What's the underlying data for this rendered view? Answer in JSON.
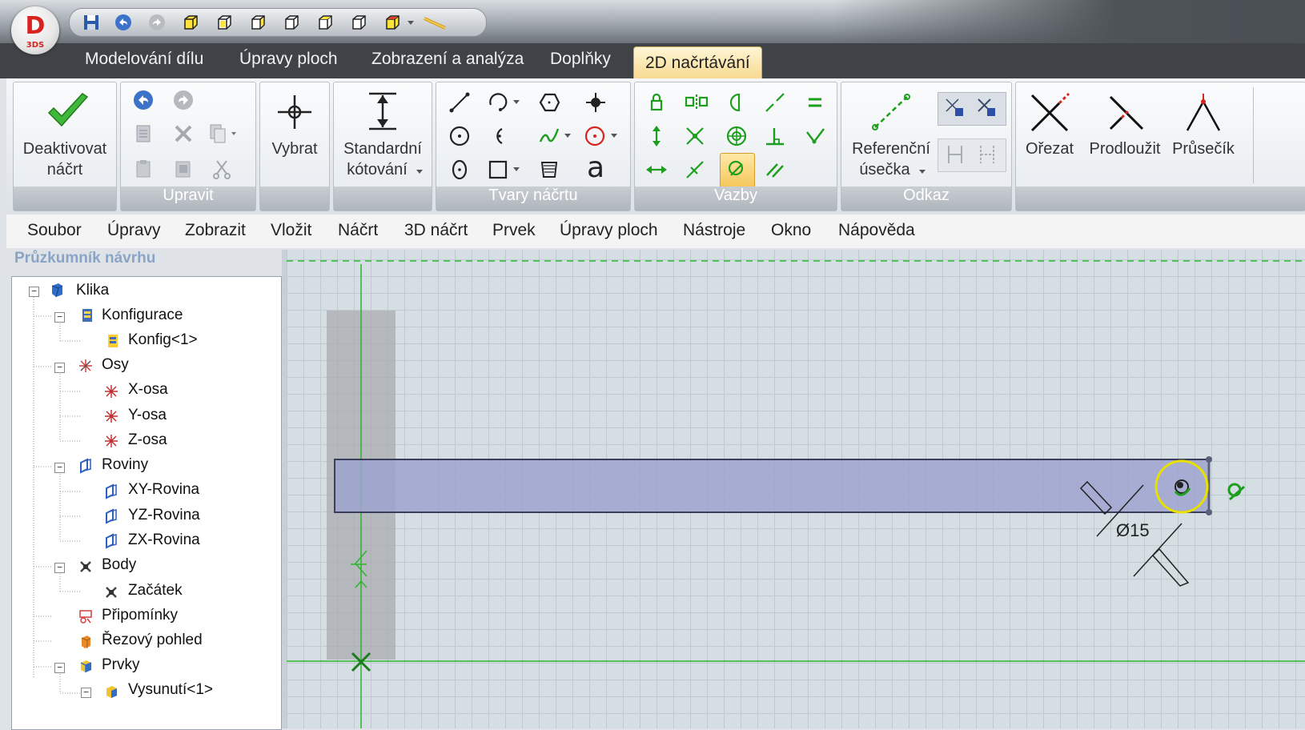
{
  "app": {
    "logo_letter": "D",
    "logo_sub": "3DS"
  },
  "tabs": [
    "Modelování dílu",
    "Úpravy ploch",
    "Zobrazení a analýza",
    "Doplňky",
    "2D načrtávání"
  ],
  "active_tab": "2D načrtávání",
  "ribbon": {
    "deactivate": {
      "line1": "Deaktivovat",
      "line2": "náčrt"
    },
    "select": "Vybrat",
    "dimension": {
      "line1": "Standardní",
      "line2": "kótování"
    },
    "text_tool": "a",
    "reference": {
      "line1": "Referenční",
      "line2": "úsečka"
    },
    "trim": "Ořezat",
    "extend": "Prodloužit",
    "intersect": "Průsečík",
    "groups": {
      "edit": "Upravit",
      "shapes": "Tvary náčrtu",
      "constraints": "Vazby",
      "reference": "Odkaz"
    }
  },
  "menu": [
    "Soubor",
    "Úpravy",
    "Zobrazit",
    "Vložit",
    "Náčrt",
    "3D náčrt",
    "Prvek",
    "Úpravy ploch",
    "Nástroje",
    "Okno",
    "Nápověda"
  ],
  "explorer": {
    "title": "Průzkumník návrhu",
    "tree": [
      "Klika",
      "Konfigurace",
      "Konfig<1>",
      "Osy",
      "X-osa",
      "Y-osa",
      "Z-osa",
      "Roviny",
      "XY-Rovina",
      "YZ-Rovina",
      "ZX-Rovina",
      "Body",
      "Začátek",
      "Připomínky",
      "Řezový pohled",
      "Prvky",
      "Vysunutí<1>"
    ]
  },
  "sketch": {
    "dimension_label": "Ø15"
  },
  "colors": {
    "accent_tab": "#f7d98e",
    "sketch_green": "#2db52d",
    "constraint_green": "#1e9e1e",
    "rect_fill": "#9ea3cf",
    "highlight_yellow": "#e9e000"
  }
}
